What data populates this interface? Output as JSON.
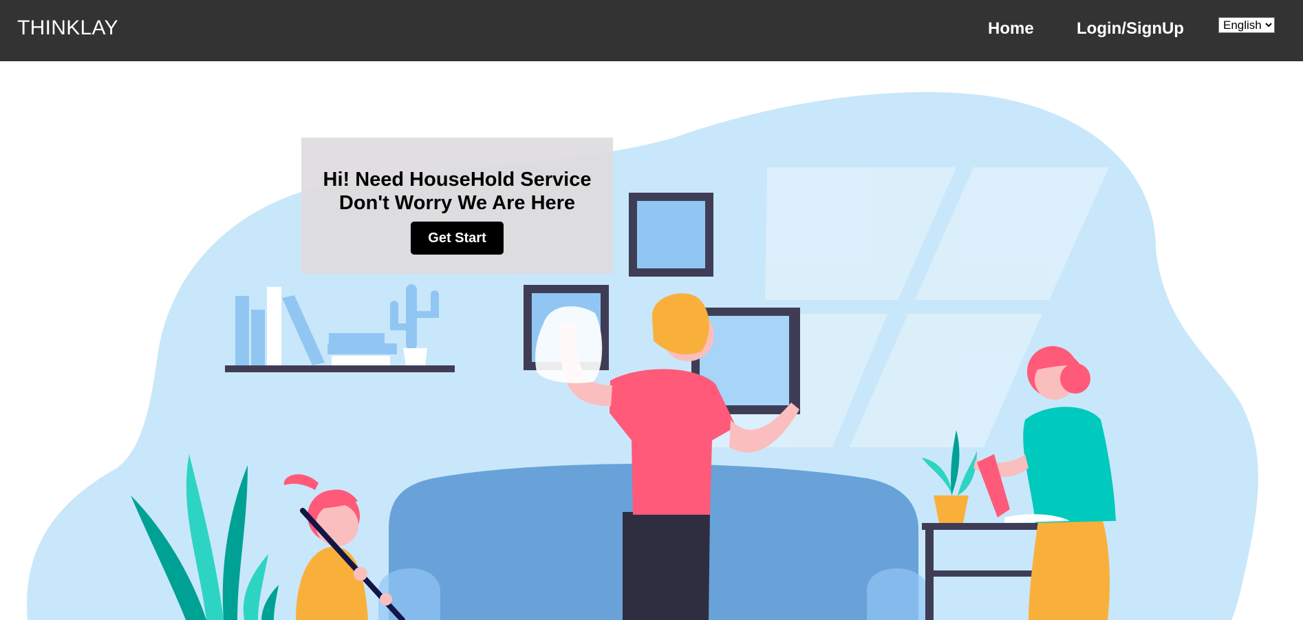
{
  "navbar": {
    "brand": "THINKLAY",
    "links": [
      {
        "label": "Home"
      },
      {
        "label": "Login/SignUp"
      }
    ],
    "language": {
      "selected": "English"
    }
  },
  "hero": {
    "headline_line1": "Hi! Need HouseHold Service",
    "headline_line2": "Don't Worry We Are Here",
    "cta_label": "Get Start"
  },
  "colors": {
    "navbar_bg": "#333333",
    "blob": "#c9e7fa",
    "sofa": "#68a2d9",
    "frame": "#3f3d56",
    "shirt_red": "#ff5a79",
    "teal": "#00c9bd",
    "hair_orange": "#f9b03b",
    "card_bg": "#dedcde",
    "button_bg": "#000000"
  }
}
